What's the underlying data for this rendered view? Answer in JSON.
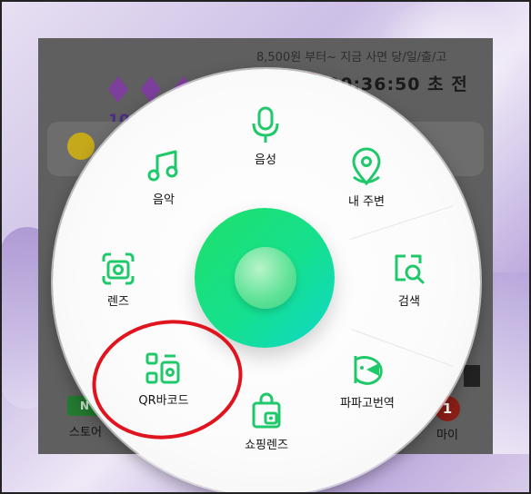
{
  "background_page": {
    "promo_time": "10시종료",
    "deal_text": "8,500원 부터~ 지금 사면 당/일/출/고",
    "countdown": "00:36:50 초 전"
  },
  "bottom_nav": {
    "store_icon_text": "N",
    "store_label": "스토어",
    "my_badge": "1",
    "my_label": "마이"
  },
  "radial_menu": {
    "items": [
      {
        "label": "음성",
        "icon": "microphone-icon"
      },
      {
        "label": "내 주변",
        "icon": "location-pin-icon"
      },
      {
        "label": "검색",
        "icon": "image-search-icon"
      },
      {
        "label": "파파고번역",
        "icon": "papago-translate-icon"
      },
      {
        "label": "쇼핑렌즈",
        "icon": "shopping-bag-lens-icon"
      },
      {
        "label": "QR바코드",
        "icon": "qr-barcode-icon"
      },
      {
        "label": "렌즈",
        "icon": "lens-camera-icon"
      },
      {
        "label": "음악",
        "icon": "music-note-icon"
      }
    ]
  },
  "colors": {
    "accent_green": "#1fc96a",
    "highlight_red": "#e0141e"
  }
}
